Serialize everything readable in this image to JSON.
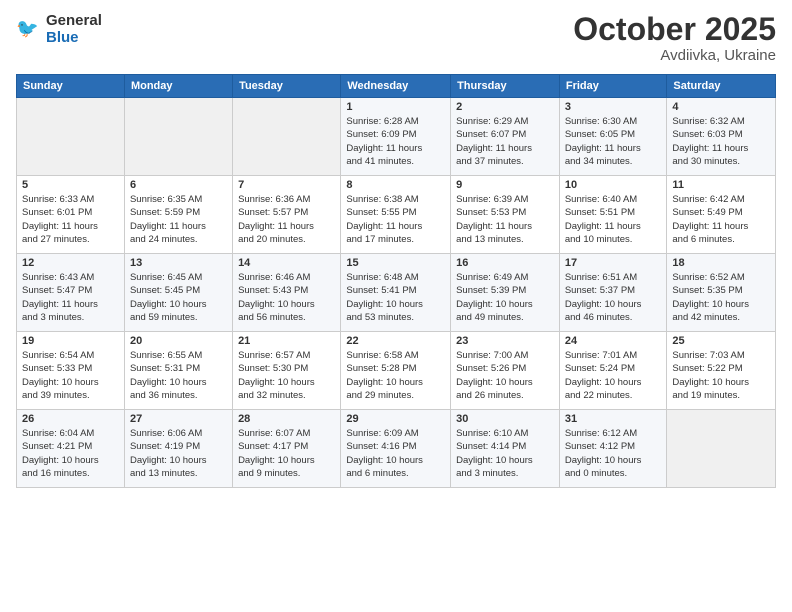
{
  "header": {
    "logo_general": "General",
    "logo_blue": "Blue",
    "month": "October 2025",
    "location": "Avdiivka, Ukraine"
  },
  "weekdays": [
    "Sunday",
    "Monday",
    "Tuesday",
    "Wednesday",
    "Thursday",
    "Friday",
    "Saturday"
  ],
  "weeks": [
    [
      {
        "day": "",
        "info": ""
      },
      {
        "day": "",
        "info": ""
      },
      {
        "day": "",
        "info": ""
      },
      {
        "day": "1",
        "info": "Sunrise: 6:28 AM\nSunset: 6:09 PM\nDaylight: 11 hours\nand 41 minutes."
      },
      {
        "day": "2",
        "info": "Sunrise: 6:29 AM\nSunset: 6:07 PM\nDaylight: 11 hours\nand 37 minutes."
      },
      {
        "day": "3",
        "info": "Sunrise: 6:30 AM\nSunset: 6:05 PM\nDaylight: 11 hours\nand 34 minutes."
      },
      {
        "day": "4",
        "info": "Sunrise: 6:32 AM\nSunset: 6:03 PM\nDaylight: 11 hours\nand 30 minutes."
      }
    ],
    [
      {
        "day": "5",
        "info": "Sunrise: 6:33 AM\nSunset: 6:01 PM\nDaylight: 11 hours\nand 27 minutes."
      },
      {
        "day": "6",
        "info": "Sunrise: 6:35 AM\nSunset: 5:59 PM\nDaylight: 11 hours\nand 24 minutes."
      },
      {
        "day": "7",
        "info": "Sunrise: 6:36 AM\nSunset: 5:57 PM\nDaylight: 11 hours\nand 20 minutes."
      },
      {
        "day": "8",
        "info": "Sunrise: 6:38 AM\nSunset: 5:55 PM\nDaylight: 11 hours\nand 17 minutes."
      },
      {
        "day": "9",
        "info": "Sunrise: 6:39 AM\nSunset: 5:53 PM\nDaylight: 11 hours\nand 13 minutes."
      },
      {
        "day": "10",
        "info": "Sunrise: 6:40 AM\nSunset: 5:51 PM\nDaylight: 11 hours\nand 10 minutes."
      },
      {
        "day": "11",
        "info": "Sunrise: 6:42 AM\nSunset: 5:49 PM\nDaylight: 11 hours\nand 6 minutes."
      }
    ],
    [
      {
        "day": "12",
        "info": "Sunrise: 6:43 AM\nSunset: 5:47 PM\nDaylight: 11 hours\nand 3 minutes."
      },
      {
        "day": "13",
        "info": "Sunrise: 6:45 AM\nSunset: 5:45 PM\nDaylight: 10 hours\nand 59 minutes."
      },
      {
        "day": "14",
        "info": "Sunrise: 6:46 AM\nSunset: 5:43 PM\nDaylight: 10 hours\nand 56 minutes."
      },
      {
        "day": "15",
        "info": "Sunrise: 6:48 AM\nSunset: 5:41 PM\nDaylight: 10 hours\nand 53 minutes."
      },
      {
        "day": "16",
        "info": "Sunrise: 6:49 AM\nSunset: 5:39 PM\nDaylight: 10 hours\nand 49 minutes."
      },
      {
        "day": "17",
        "info": "Sunrise: 6:51 AM\nSunset: 5:37 PM\nDaylight: 10 hours\nand 46 minutes."
      },
      {
        "day": "18",
        "info": "Sunrise: 6:52 AM\nSunset: 5:35 PM\nDaylight: 10 hours\nand 42 minutes."
      }
    ],
    [
      {
        "day": "19",
        "info": "Sunrise: 6:54 AM\nSunset: 5:33 PM\nDaylight: 10 hours\nand 39 minutes."
      },
      {
        "day": "20",
        "info": "Sunrise: 6:55 AM\nSunset: 5:31 PM\nDaylight: 10 hours\nand 36 minutes."
      },
      {
        "day": "21",
        "info": "Sunrise: 6:57 AM\nSunset: 5:30 PM\nDaylight: 10 hours\nand 32 minutes."
      },
      {
        "day": "22",
        "info": "Sunrise: 6:58 AM\nSunset: 5:28 PM\nDaylight: 10 hours\nand 29 minutes."
      },
      {
        "day": "23",
        "info": "Sunrise: 7:00 AM\nSunset: 5:26 PM\nDaylight: 10 hours\nand 26 minutes."
      },
      {
        "day": "24",
        "info": "Sunrise: 7:01 AM\nSunset: 5:24 PM\nDaylight: 10 hours\nand 22 minutes."
      },
      {
        "day": "25",
        "info": "Sunrise: 7:03 AM\nSunset: 5:22 PM\nDaylight: 10 hours\nand 19 minutes."
      }
    ],
    [
      {
        "day": "26",
        "info": "Sunrise: 6:04 AM\nSunset: 4:21 PM\nDaylight: 10 hours\nand 16 minutes."
      },
      {
        "day": "27",
        "info": "Sunrise: 6:06 AM\nSunset: 4:19 PM\nDaylight: 10 hours\nand 13 minutes."
      },
      {
        "day": "28",
        "info": "Sunrise: 6:07 AM\nSunset: 4:17 PM\nDaylight: 10 hours\nand 9 minutes."
      },
      {
        "day": "29",
        "info": "Sunrise: 6:09 AM\nSunset: 4:16 PM\nDaylight: 10 hours\nand 6 minutes."
      },
      {
        "day": "30",
        "info": "Sunrise: 6:10 AM\nSunset: 4:14 PM\nDaylight: 10 hours\nand 3 minutes."
      },
      {
        "day": "31",
        "info": "Sunrise: 6:12 AM\nSunset: 4:12 PM\nDaylight: 10 hours\nand 0 minutes."
      },
      {
        "day": "",
        "info": ""
      }
    ]
  ]
}
